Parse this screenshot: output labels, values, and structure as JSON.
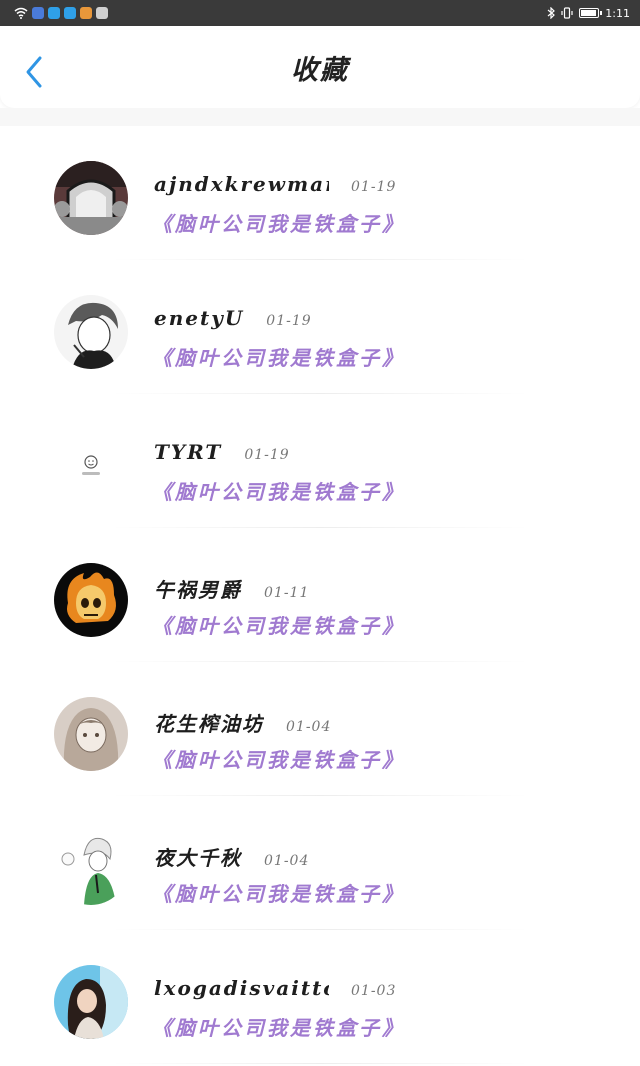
{
  "status_bar": {
    "time": "1:11",
    "icons": [
      "wifi-icon",
      "app-icon-1",
      "app-icon-2",
      "app-icon-3",
      "app-icon-4",
      "app-icon-5",
      "bluetooth-icon",
      "vibrate-icon",
      "battery-icon"
    ],
    "app_colors": [
      "#4a7bd9",
      "#2fa0e8",
      "#e8973a",
      "#7a7a7a",
      "#d44a4a"
    ]
  },
  "header": {
    "title": "收藏",
    "back_icon": "chevron-left-icon",
    "accent": "#2f95e4"
  },
  "colors": {
    "book_title": "#a07ad0",
    "username": "#1e1e1e",
    "date": "#777777"
  },
  "items": [
    {
      "username": "ajndxkrewmarmc",
      "date": "01-19",
      "book_title": "《脑叶公司我是铁盒子》",
      "avatar": "avatar-garden-gate"
    },
    {
      "username": "enetyU",
      "date": "01-19",
      "book_title": "《脑叶公司我是铁盒子》",
      "avatar": "avatar-sketch-boy"
    },
    {
      "username": "TYRT",
      "date": "01-19",
      "book_title": "《脑叶公司我是铁盒子》",
      "avatar": "avatar-smiley-good"
    },
    {
      "username": "午祸男爵",
      "date": "01-11",
      "book_title": "《脑叶公司我是铁盒子》",
      "avatar": "avatar-flaming-skull"
    },
    {
      "username": "花生榨油坊",
      "date": "01-04",
      "book_title": "《脑叶公司我是铁盒子》",
      "avatar": "avatar-anime-girl"
    },
    {
      "username": "夜大千秋",
      "date": "01-04",
      "book_title": "《脑叶公司我是铁盒子》",
      "avatar": "avatar-white-hair-boy"
    },
    {
      "username": "lxogadisvaittond...",
      "date": "01-03",
      "book_title": "《脑叶公司我是铁盒子》",
      "avatar": "avatar-girl-photo"
    }
  ]
}
